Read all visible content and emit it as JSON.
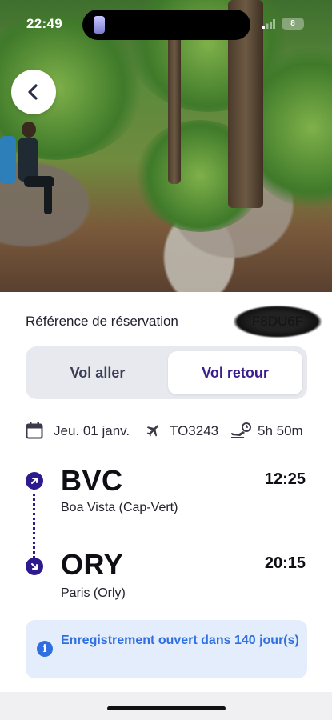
{
  "status_bar": {
    "time": "22:49",
    "battery": "8"
  },
  "header": {
    "back_icon": "chevron-left-icon"
  },
  "reservation": {
    "label": "Référence de réservation",
    "code": "F8DU6F"
  },
  "tabs": [
    {
      "label": "Vol aller",
      "selected": false
    },
    {
      "label": "Vol retour",
      "selected": true
    }
  ],
  "flight_info": {
    "date": "Jeu. 01 janv.",
    "flight_number": "TO3243",
    "duration": "5h 50m"
  },
  "departure": {
    "code": "BVC",
    "time": "12:25",
    "city": "Boa Vista (Cap-Vert)"
  },
  "arrival": {
    "code": "ORY",
    "time": "20:15",
    "city": "Paris (Orly)"
  },
  "checkin_banner": {
    "text": "Enregistrement ouvert dans 140 jour(s)"
  },
  "colors": {
    "accent": "#2d1b8e",
    "info_blue": "#2f6fe0",
    "info_bg": "#e3edfb",
    "tab_bg": "#e7e9ef"
  }
}
